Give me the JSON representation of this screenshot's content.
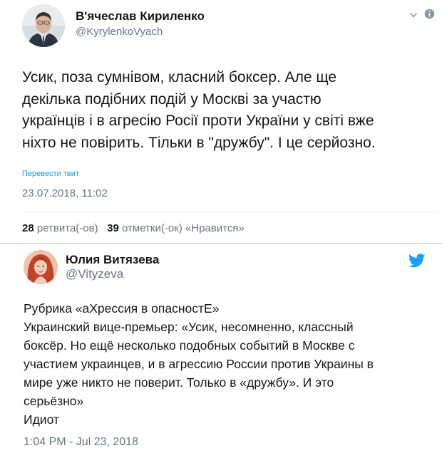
{
  "tweet1": {
    "author_name": "В'ячеслав Кириленко",
    "author_handle": "@KyrylenkoVyach",
    "text_lines": [
      "Усик, поза сумнівом, класний боксер. Але ще",
      "декілька подібних подій у Москві за участю",
      "українців і в агресію Росії проти України у світі вже",
      "ніхто не повірить. Тільки в \"дружбу\". І це серйозно."
    ],
    "translate_link": "Перевести твит",
    "date": "23.07.2018, 11:02",
    "retweets_count": "28",
    "retweets_label": "ретвита(-ов)",
    "likes_count": "39",
    "likes_label": "отметки(-ок) «Нравится»",
    "icons": [
      "chevron-down-icon",
      "info-icon"
    ]
  },
  "tweet2": {
    "author_name": "Юлия Витязева",
    "author_handle": "@Vityzeva",
    "text_lines": [
      "Рубрика «аХрессия в опасностЕ»",
      "Украинский вице-премьер: «Усик, несомненно, классный",
      "боксёр. Но ещё несколько подобных событий в Москве с",
      "участием украинцев, и в агрессию России против Украины в",
      "мире уже никто не поверит. Только в «дружбу». И это",
      "серьёзно»",
      "Идиот"
    ],
    "date": "1:04 PM - Jul 23, 2018",
    "icons": [
      "twitter-bird-icon"
    ],
    "brand_color": "#1da1f2"
  }
}
